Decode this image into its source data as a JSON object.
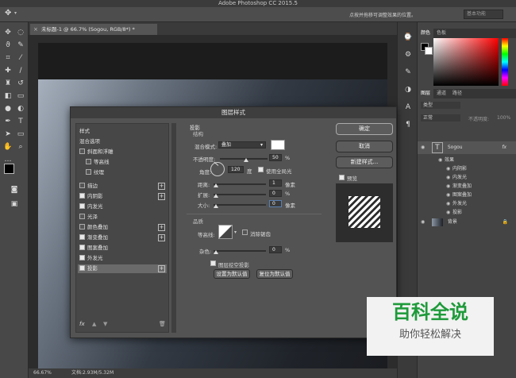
{
  "app": {
    "title": "Adobe Photoshop CC 2015.5",
    "hint": "点按并拖移可调整效果的位置。",
    "workspace": "基本功能"
  },
  "doc": {
    "tab": "未标题-1 @ 66.7% (Sogou, RGB/8*) *",
    "zoom": "66.67%",
    "info": "文档:2.93M/5.32M"
  },
  "panels": {
    "color_tabs": [
      "颜色",
      "色板"
    ],
    "layer_tabs": [
      "图层",
      "通道",
      "路径"
    ],
    "filter_kind": "类型",
    "blend": "正常",
    "opacity_label": "不透明度:",
    "opacity": "100%",
    "layers": [
      {
        "name": "Sogou",
        "fx": "fx"
      },
      {
        "name": "效果"
      },
      {
        "name": "内阴影"
      },
      {
        "name": "内发光"
      },
      {
        "name": "渐变叠加"
      },
      {
        "name": "图案叠加"
      },
      {
        "name": "外发光"
      },
      {
        "name": "投影"
      },
      {
        "name": "背景"
      }
    ]
  },
  "dialog": {
    "title": "图层样式",
    "styles_header": "样式",
    "blend_options": "混合选项",
    "items": [
      {
        "label": "斜面和浮雕",
        "on": false
      },
      {
        "label": "等高线",
        "on": false
      },
      {
        "label": "纹理",
        "on": false
      },
      {
        "label": "描边",
        "on": false
      },
      {
        "label": "内阴影",
        "on": true
      },
      {
        "label": "内发光",
        "on": true
      },
      {
        "label": "光泽",
        "on": false
      },
      {
        "label": "颜色叠加",
        "on": false
      },
      {
        "label": "渐变叠加",
        "on": true
      },
      {
        "label": "图案叠加",
        "on": true
      },
      {
        "label": "外发光",
        "on": true
      },
      {
        "label": "投影",
        "on": true
      }
    ],
    "section": "投影",
    "structure": "结构",
    "blend_mode_label": "混合模式:",
    "blend_mode": "叠加",
    "opacity_label": "不透明度:",
    "opacity_value": "50",
    "angle_label": "角度:",
    "angle_value": "120",
    "degree": "度",
    "global_light": "使用全局光",
    "distance_label": "距离:",
    "distance_value": "1",
    "spread_label": "扩展:",
    "spread_value": "0",
    "size_label": "大小:",
    "size_value": "0",
    "px": "像素",
    "pct": "%",
    "quality": "品质",
    "contour_label": "等高线:",
    "antialias": "消除锯齿",
    "noise_label": "杂色:",
    "noise_value": "0",
    "knockout": "图层挖空投影",
    "set_default": "设置为默认值",
    "reset_default": "复位为默认值",
    "ok": "确定",
    "cancel": "取消",
    "new_style": "新建样式...",
    "preview": "预览",
    "fx": "fx"
  },
  "watermark": {
    "line1": "百科全说",
    "line2": "助你轻松解决"
  }
}
